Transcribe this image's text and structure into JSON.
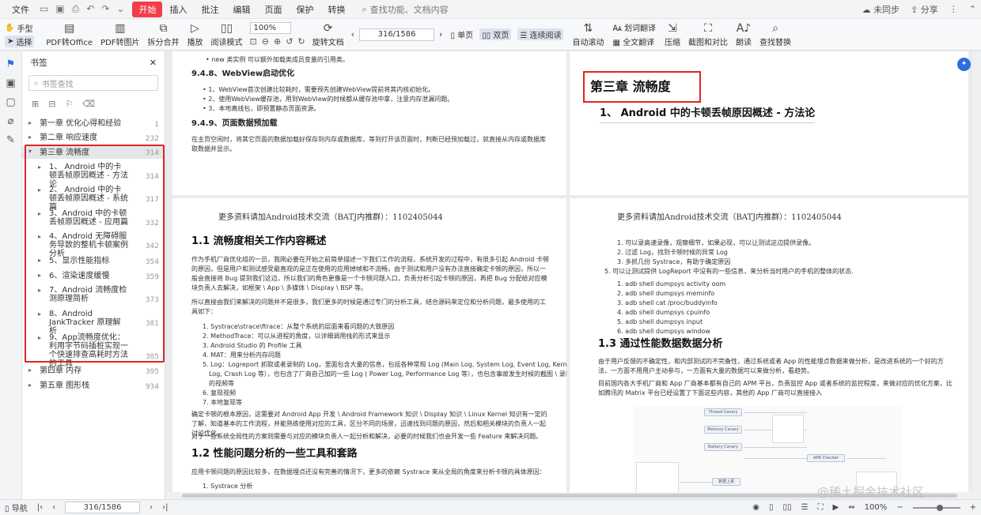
{
  "menu": {
    "items": [
      "文件",
      "开始",
      "插入",
      "批注",
      "编辑",
      "页面",
      "保护",
      "转换"
    ],
    "active_index": 1,
    "search_placeholder": "查找功能、文档内容",
    "sync": "未同步",
    "share": "分享"
  },
  "toolbar": {
    "hand": "手型",
    "select": "选择",
    "buttons": [
      "PDF转Office",
      "PDF转图片",
      "拆分合并",
      "播放",
      "阅读模式"
    ],
    "zoom": "100%",
    "rotate": "旋转文档",
    "page_indicator": "316/1586",
    "single_page": "单页",
    "double_page": "双页",
    "continuous": "连续阅读",
    "auto_scroll": "自动滚动",
    "translate": "划词翻译",
    "full_translate": "全文翻译",
    "compress": "压缩",
    "screenshot_compare": "截图和对比",
    "read_aloud": "朗读",
    "find_replace": "查找替换"
  },
  "panel": {
    "title": "书签",
    "search_placeholder": "书签查找",
    "bookmarks": [
      {
        "label": "第一章 优化心得和经验",
        "page": "1"
      },
      {
        "label": "第二章 响应速度",
        "page": "232"
      },
      {
        "label": "第三章 流畅度",
        "page": "314"
      },
      {
        "label": "1、 Android 中的卡顿丢帧原因概述 - 方法论",
        "page": "314"
      },
      {
        "label": "2、 Android 中的卡顿丢帧原因概述 - 系统篇",
        "page": "317"
      },
      {
        "label": "3、Android 中的卡顿丢帧原因概述 - 应用篇",
        "page": "332"
      },
      {
        "label": "4、Android 无障碍服务导致的整机卡顿案例分析",
        "page": "342"
      },
      {
        "label": "5、显示性能指标",
        "page": "354"
      },
      {
        "label": "6、渲染速度缓慢",
        "page": "359"
      },
      {
        "label": "7、Android 流畅度检测原理简析",
        "page": "373"
      },
      {
        "label": "8、Android JankTracker 原理解析",
        "page": "381"
      },
      {
        "label": "9、App流畅度优化：利用字节码插桩实现一个快速排查高耗时方法的工具",
        "page": "385"
      },
      {
        "label": "第四章 内存",
        "page": "395"
      },
      {
        "label": "第五章 图形栈",
        "page": "934"
      }
    ]
  },
  "doc": {
    "p1": {
      "top_item": "new 类实例 可以额外加载类成员变量的引用类。",
      "h_948": "9.4.8、WebView启动优化",
      "items_948": [
        "1、WebView首次创建比较耗时，需要预先创建WebView提前将其内核初始化。",
        "2、使用WebView缓存池，用到WebView的时候都从缓存池中拿，注意内存泄漏问题。",
        "3、本地离线包，即预置静态页面资源。"
      ],
      "h_949": "9.4.9、页面数据预加载",
      "para_949": "在主页空闲时，将其它页面的数据加载好保存到内存或数据库，等到打开该页面时，判断已经预加载过，就直接从内存或数据库取数据并显示。"
    },
    "p2": {
      "chapter": "第三章 流畅度",
      "heading": "1、 Android 中的卡顿丢帧原因概述 - 方法论"
    },
    "p3": {
      "promo": "更多资料请加Android技术交流（BATJ内推群）：1102405044",
      "h11": "1.1 流畅度相关工作内容概述",
      "para1": "作为手机厂商优化组的一员，我刚必要在开始之前简单描述一下我们工作的流程，系统开发的过程中，有很多引起 Android 卡顿的原因，但是用户和测试感受最直观的是正在使用的应用掉帧和不流畅，由于测试和用户没有办法直接确定卡顿的原因，所以一般会直接将 Bug 提到我们这边，所以我们的角色更像是一个卡顿问题入口，负责分析引起卡顿的原因，再把 Bug 分配给对应模块负责人去解决，如框架 \\ App \\ 多媒体 \\ Display \\ BSP 等。",
      "para2": "所以直接由我们来解决的问题并不是很多，我们更多的时候是通过专门的分析工具，结合源码来定位和分析问题，最多使用的工具如下：",
      "tools": [
        "1. Systrace\\strace\\ftrace：从整个系统的层面来看问题的大致原因",
        "2. MethodTrace：可以从进程的角度，以详细调用栈的形式来显示",
        "3. Android Studio 的 Profile 工具",
        "4. MAT：用来分析内存问题",
        "5. Log：Logreport 抓取或者录制的 Log，里面包含大量的信息，包括各种常规 Log (Main Log, System Log, Event Log, Kernel",
        "Log, Crash Log 等），也包含了厂商自己加的一些 Log ( Power Log, Performance Log 等），也包含事故发生时候的截图 \\ 录制",
        "的视频等",
        "6. 复现视频",
        "7. 本地复现等"
      ],
      "para3": "确定卡顿的根本原因，这需要对 Android App 开发 \\ Android Framework 知识 \\ Display 知识 \\ Linux Kernel 知识有一定的了解，知道基本的工作流程，并能熟练使用对应的工具，区分不同的场景，迅速找到问题的原因，然后和相关模块的负责人一起讨论优化。",
      "para4": "对于一些系统全局性的方案则需要与对应的模块负责人一起分析和解决，必要的时候我们也会开发一些 Feature 来解决问题。",
      "h12": "1.2 性能问题分析的一些工具和套路",
      "para5": "应用卡顿问题的原因比较多，在数据埋点还没有完善的情况下，更多的依赖 Systrace 来从全局的角度来分析卡顿的具体原因：",
      "last": "1. Systrace 分析"
    },
    "p4": {
      "promo": "更多资料请加Android技术交流（BATJ内推群）：1102405044",
      "steps": [
        "1. 可以录高速录像，观察细节，如果必现，可以让测试这边提供录像。",
        "2. 过滤 Log，找到卡顿时候的异常 Log",
        "3. 多抓几份 Systrace，有助于确定原因"
      ],
      "step5": "5. 可以让测试提供 LogReport 中没有的一些信息，来分析当时用户的手机的整体的状态.",
      "commands": [
        "1. adb shell dumpsys activity oom",
        "2. adb shell dumpsys meminfo",
        "3. adb shell cat /proc/buddyinfo",
        "4. adb shell dumpsys cpuinfo",
        "5. adb shell dumpsys input",
        "6. adb shell dumpsys window"
      ],
      "h13": "1.3 通过性能数据数据分析",
      "para1": "由于用户反馈的不确定性，和内部测试的不完备性，通过系统或者 App 的性能埋点数据来做分析，是改进系统的一个好的方法，一方面不用用户主动参与，一方面有大量的数据可以来做分析，看趋势。",
      "para2": "目前国内各大手机厂商和 App 厂商基本都有自己的 APM 平台，负责监控 App 或者系统的监控程度，来做对应的优化方案，比如腾讯的 Matrix 平台已经设置了下面这些内容，其他的 App 厂商可以直接接入",
      "diagram_nodes": [
        "Thread Canary",
        "Memory Canary",
        "Battery Canary",
        "APK Checker",
        "数据上报"
      ]
    }
  },
  "status": {
    "nav": "导航",
    "page_indicator": "316/1586",
    "zoom": "100%"
  },
  "watermark": "@稀土掘金技术社区"
}
